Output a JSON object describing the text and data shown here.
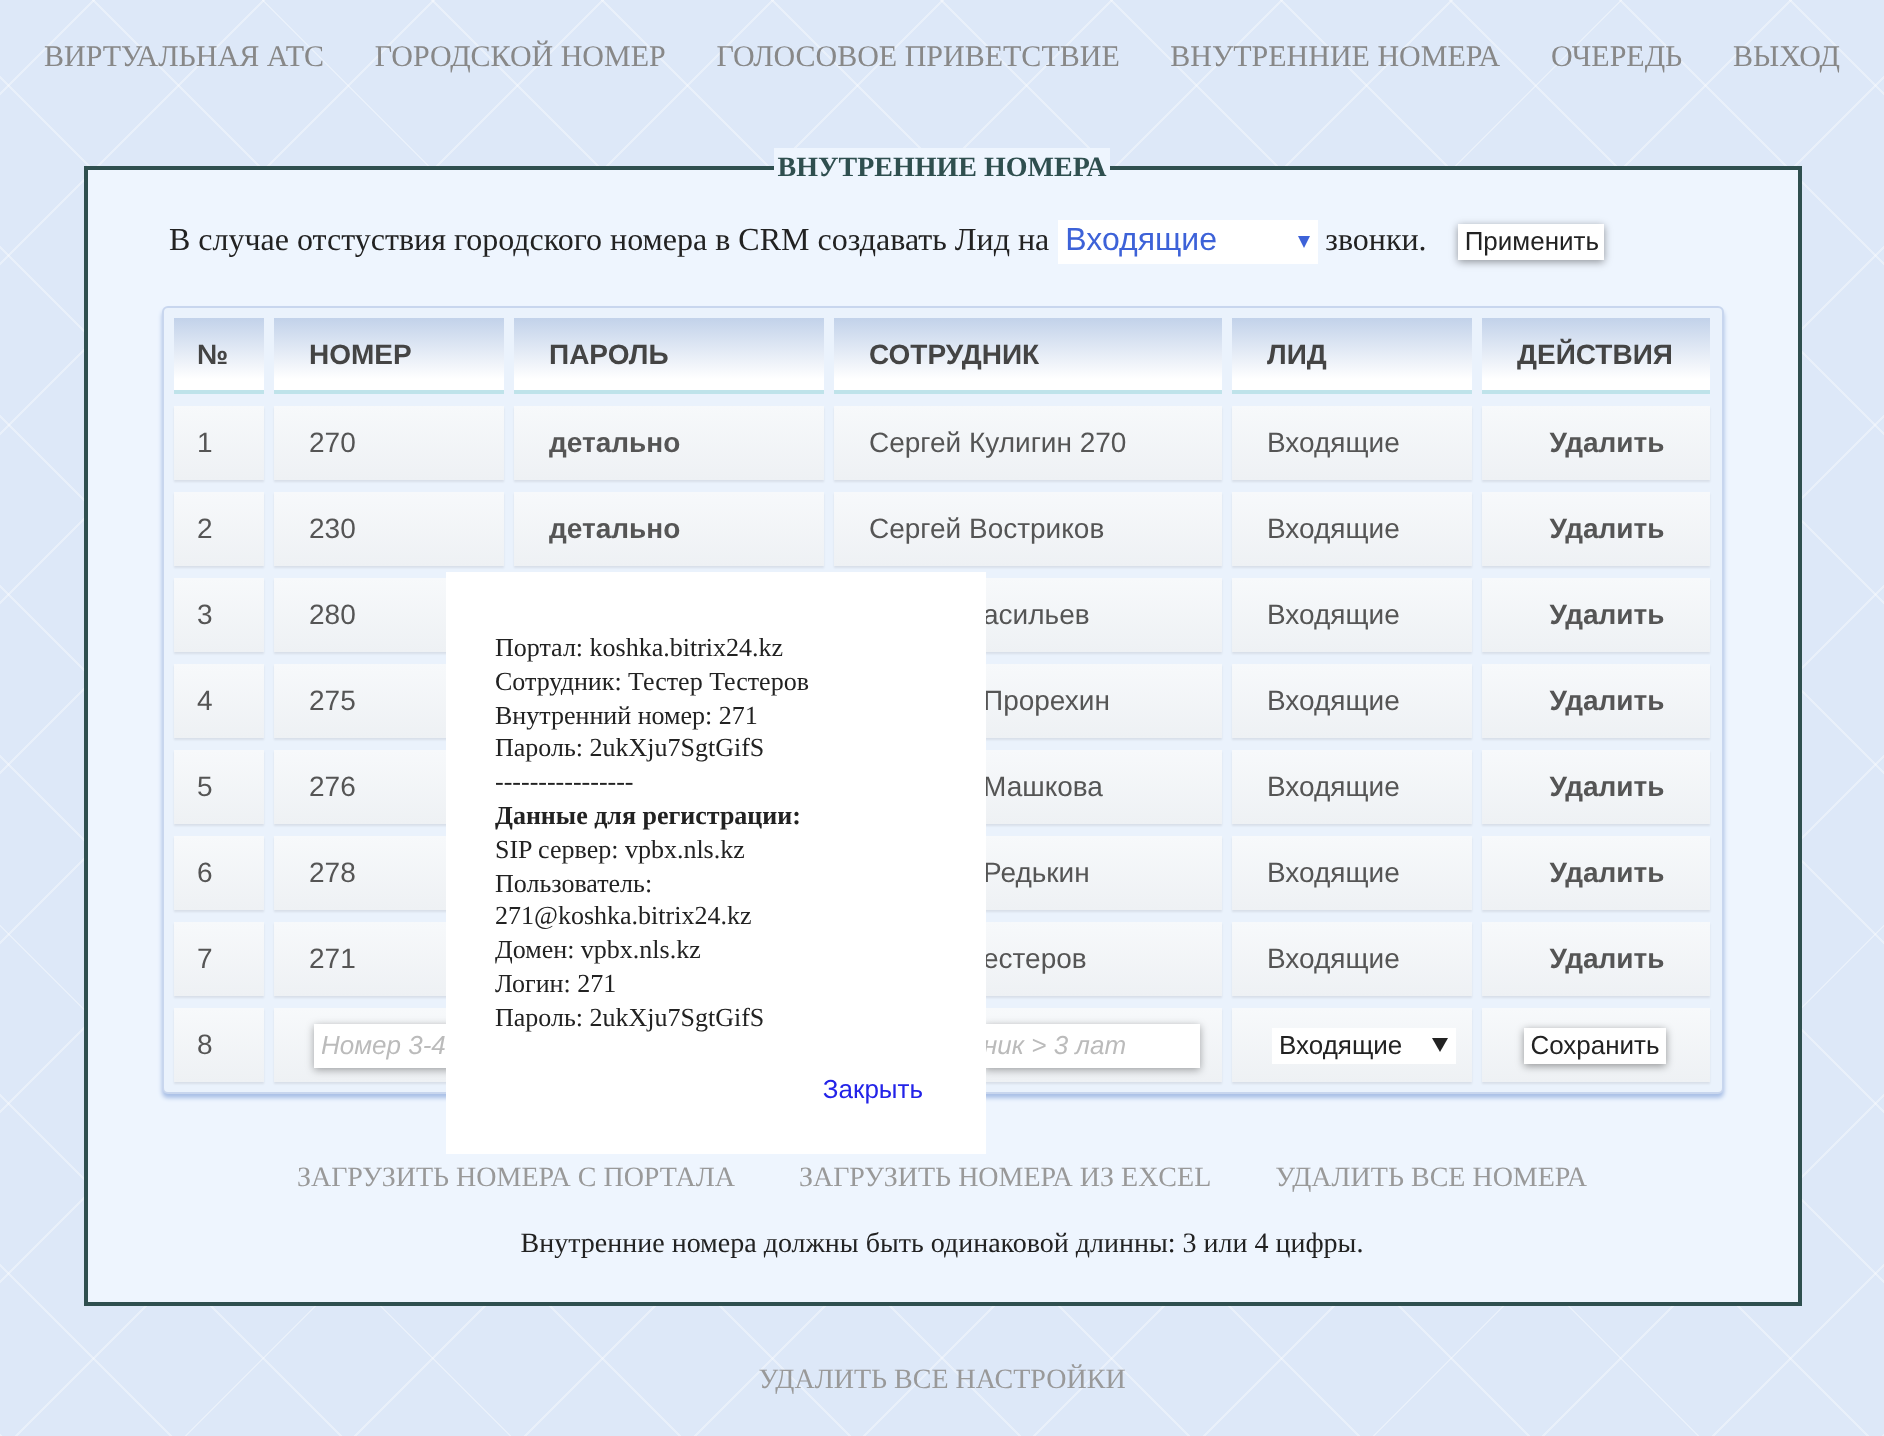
{
  "nav": [
    "ВИРТУАЛЬНАЯ АТС",
    "ГОРОДСКОЙ НОМЕР",
    "ГОЛОСОВОЕ ПРИВЕТСТВИЕ",
    "ВНУТРЕННИЕ НОМЕРА",
    "ОЧЕРЕДЬ",
    "ВЫХОД"
  ],
  "section": {
    "title": "ВНУТРЕННИЕ НОМЕРА",
    "crm_rule": {
      "text_before": "В случае отстуствия городского номера в CRM создавать Лид на",
      "value": "Входящие",
      "text_after": "звонки.",
      "button": "Применить"
    },
    "table": {
      "columns": [
        "№",
        "НОМЕР",
        "ПАРОЛЬ",
        "СОТРУДНИК",
        "ЛИД",
        "ДЕЙСТВИЯ"
      ],
      "rows": [
        {
          "kind": "row",
          "index": "1",
          "number": "270",
          "password": "детально",
          "employee": "Сергей Кулигин 270",
          "lead": "Входящие",
          "action": "Удалить"
        },
        {
          "kind": "row",
          "index": "2",
          "number": "230",
          "password": "детально",
          "employee": "Сергей Востриков",
          "lead": "Входящие",
          "action": "Удалить"
        },
        {
          "kind": "covered",
          "index": "3",
          "number": "280",
          "employee": "асильев",
          "lead": "Входящие",
          "action": "Удалить"
        },
        {
          "kind": "covered",
          "index": "4",
          "number": "275",
          "employee": "Прорехин",
          "lead": "Входящие",
          "action": "Удалить"
        },
        {
          "kind": "covered",
          "index": "5",
          "number": "276",
          "employee": "Машкова",
          "lead": "Входящие",
          "action": "Удалить"
        },
        {
          "kind": "covered",
          "index": "6",
          "number": "278",
          "employee": "Редькин",
          "lead": "Входящие",
          "action": "Удалить"
        },
        {
          "kind": "covered",
          "index": "7",
          "number": "271",
          "employee": "естеров",
          "lead": "Входящие",
          "action": "Удалить"
        },
        {
          "kind": "new",
          "index": "8",
          "number_placeholder": "Номер 3-4",
          "employee_placeholder": "ник > 3 лат",
          "lead": "Входящие",
          "action": "Сохранить"
        }
      ]
    },
    "actions": [
      "ЗАГРУЗИТЬ НОМЕРА С ПОРТАЛА",
      "ЗАГРУЗИТЬ НОМЕРА ИЗ EXCEL",
      "УДАЛИТЬ ВСЕ НОМЕРА"
    ],
    "note": "Внутренние номера должны быть одинаковой длинны: 3 или 4 цифры.",
    "popup": {
      "lines": [
        {
          "kind": "text",
          "text": "Портал: koshka.bitrix24.kz"
        },
        {
          "kind": "text",
          "text": "Сотрудник: Тестер Тестеров"
        },
        {
          "kind": "text",
          "text": "Внутренний номер: 271"
        },
        {
          "kind": "text",
          "text": "Пароль: 2ukXju7SgtGifS"
        },
        {
          "kind": "text",
          "text": "----------------"
        },
        {
          "kind": "heading",
          "text": "Данные для регистрации:"
        },
        {
          "kind": "text",
          "text": "SIP сервер: vpbx.nls.kz"
        },
        {
          "kind": "text",
          "text": "Пользователь:"
        },
        {
          "kind": "text",
          "text": "271@koshka.bitrix24.kz"
        },
        {
          "kind": "text",
          "text": "Домен: vpbx.nls.kz"
        },
        {
          "kind": "text",
          "text": "Логин: 271"
        },
        {
          "kind": "text",
          "text": "Пароль: 2ukXju7SgtGifS"
        }
      ],
      "close": "Закрыть"
    }
  },
  "footer_link": "УДАЛИТЬ ВСЕ НАСТРОЙКИ"
}
